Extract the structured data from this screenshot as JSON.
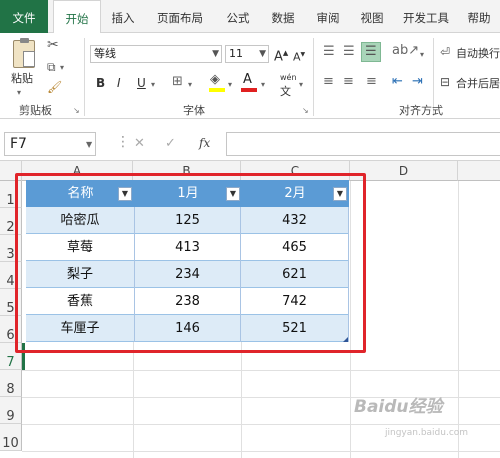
{
  "tabs": [
    "文件",
    "开始",
    "插入",
    "页面布局",
    "公式",
    "数据",
    "审阅",
    "视图",
    "开发工具",
    "帮助"
  ],
  "ribbon": {
    "clipboard": {
      "paste": "粘贴",
      "group": "剪贴板"
    },
    "font": {
      "name": "等线",
      "size": "11",
      "bold": "B",
      "italic": "I",
      "underline": "U",
      "grow": "A",
      "shrink": "A",
      "wen": "wén",
      "group": "字体"
    },
    "align": {
      "wrap": "自动换行",
      "merge": "合并后居",
      "group": "对齐方式"
    }
  },
  "formula": {
    "namebox": "F7",
    "fx": "fx",
    "cancel": "✕",
    "enter": "✓"
  },
  "columns": [
    "A",
    "B",
    "C",
    "D"
  ],
  "rows": [
    "1",
    "2",
    "3",
    "4",
    "5",
    "6",
    "7",
    "8",
    "9",
    "10"
  ],
  "table": {
    "headers": [
      "名称",
      "1月",
      "2月"
    ],
    "rows": [
      [
        "哈密瓜",
        "125",
        "432"
      ],
      [
        "草莓",
        "413",
        "465"
      ],
      [
        "梨子",
        "234",
        "621"
      ],
      [
        "香蕉",
        "238",
        "742"
      ],
      [
        "车厘子",
        "146",
        "521"
      ]
    ]
  },
  "colors": {
    "excel_green": "#217346",
    "header_blue": "#5b9bd5",
    "band_blue": "#ddebf7",
    "highlight_red": "#e0242a"
  },
  "watermark": {
    "logo": "Baidu经验",
    "url": "jingyan.baidu.com"
  }
}
